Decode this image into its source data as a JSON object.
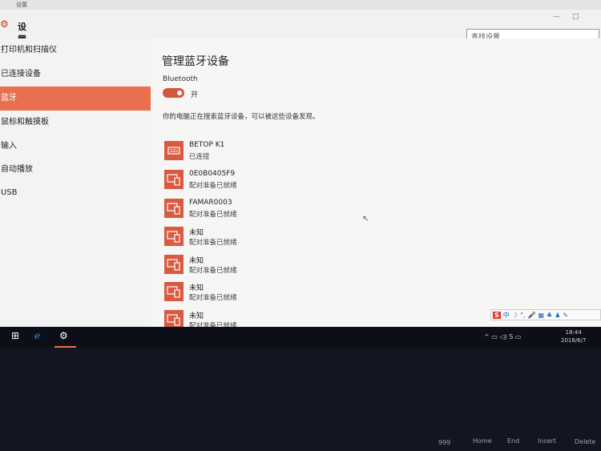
{
  "window": {
    "title": "设置",
    "app_name": "设置"
  },
  "search": {
    "placeholder": "查找设置"
  },
  "sidebar": {
    "items": [
      {
        "label": "打印机和扫描仪",
        "active": false
      },
      {
        "label": "已连接设备",
        "active": false
      },
      {
        "label": "蓝牙",
        "active": true
      },
      {
        "label": "鼠标和触摸板",
        "active": false
      },
      {
        "label": "输入",
        "active": false
      },
      {
        "label": "自动播放",
        "active": false
      },
      {
        "label": "USB",
        "active": false
      }
    ]
  },
  "main": {
    "title": "管理蓝牙设备",
    "bluetooth_label": "Bluetooth",
    "toggle_state": "开",
    "discover_text": "你的电脑正在搜索蓝牙设备，可以被这些设备发现。",
    "devices": [
      {
        "name": "BETOP K1",
        "status": "已连接",
        "icon": "keyboard-icon"
      },
      {
        "name": "0E0B0405F9",
        "status": "配对准备已就绪",
        "icon": "phone-pc-icon"
      },
      {
        "name": "FAMAR0003",
        "status": "配对准备已就绪",
        "icon": "phone-pc-icon"
      },
      {
        "name": "未知",
        "status": "配对准备已就绪",
        "icon": "phone-pc-icon"
      },
      {
        "name": "未知",
        "status": "配对准备已就绪",
        "icon": "phone-pc-icon"
      },
      {
        "name": "未知",
        "status": "配对准备已就绪",
        "icon": "phone-pc-icon"
      },
      {
        "name": "未知",
        "status": "配对准备已就绪",
        "icon": "phone-pc-icon"
      }
    ]
  },
  "ime": {
    "logo": "S",
    "mode": "中"
  },
  "taskbar": {
    "clock_time": "18:44",
    "clock_date": "2018/6/7"
  },
  "keyboard": {
    "keys": [
      "999",
      "Home",
      "End",
      "Insert",
      "Delete"
    ]
  },
  "colors": {
    "accent": "#e8704f",
    "device_icon": "#d85a40",
    "toggle": "#d4563e"
  }
}
